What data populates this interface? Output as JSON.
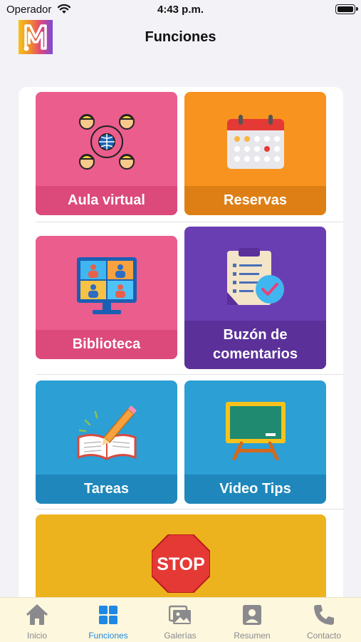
{
  "status_bar": {
    "carrier": "Operador",
    "time": "4:43 p.m."
  },
  "nav": {
    "title": "Funciones",
    "logo_letter": "M"
  },
  "tiles": [
    {
      "label": "Aula virtual",
      "color": "#ea5d8d",
      "label_bg": "#db4a7a",
      "icon": "network-people-icon"
    },
    {
      "label": "Reservas",
      "color": "#f7931e",
      "label_bg": "#de7f15",
      "icon": "calendar-icon"
    },
    {
      "label": "Biblioteca",
      "color": "#ea5d8d",
      "label_bg": "#db4a7a",
      "icon": "video-conference-icon"
    },
    {
      "label_line1": "Buzón de",
      "label_line2": "comentarios",
      "color": "#6a3eb3",
      "label_bg": "#5b3199",
      "icon": "clipboard-check-icon"
    },
    {
      "label": "Tareas",
      "color": "#2c9fd4",
      "label_bg": "#1f87bb",
      "icon": "book-pencil-icon"
    },
    {
      "label": "Video Tips",
      "color": "#2c9fd4",
      "label_bg": "#1f87bb",
      "icon": "chalkboard-icon"
    },
    {
      "label": "STOP",
      "color": "#edb31e",
      "icon": "stop-sign-icon"
    }
  ],
  "tab_bar": {
    "active_color": "#1e88e5",
    "items": [
      {
        "label": "Inicio",
        "icon": "home-icon"
      },
      {
        "label": "Funciones",
        "icon": "grid-icon",
        "active": true
      },
      {
        "label": "Galerías",
        "icon": "gallery-icon"
      },
      {
        "label": "Resumen",
        "icon": "profile-icon"
      },
      {
        "label": "Contacto",
        "icon": "phone-icon"
      }
    ]
  }
}
